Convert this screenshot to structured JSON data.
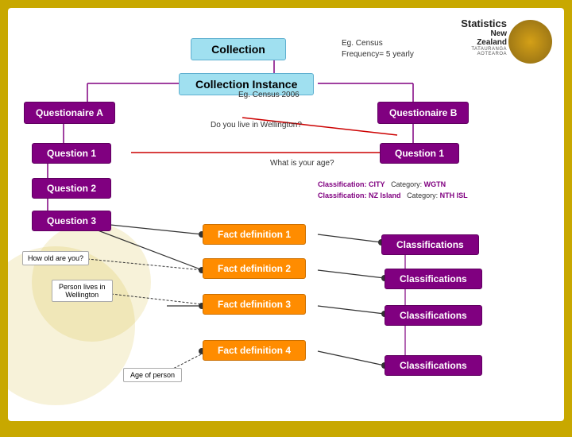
{
  "logo": {
    "line1": "Statistics",
    "line2": "New Zealand",
    "line3": "TATAURANGA AOTEAROA"
  },
  "nodes": {
    "collection": "Collection",
    "collection_instance": "Collection Instance",
    "questionnaire_a": "Questionaire A",
    "questionnaire_b": "Questionaire B",
    "question1_left": "Question 1",
    "question1_right": "Question 1",
    "question2": "Question 2",
    "question3": "Question 3",
    "fact_def_1": "Fact definition 1",
    "fact_def_2": "Fact definition 2",
    "fact_def_3": "Fact definition 3",
    "fact_def_4": "Fact definition 4",
    "classifications_1": "Classifications",
    "classifications_2": "Classifications",
    "classifications_3": "Classifications",
    "classifications_4": "Classifications"
  },
  "labels": {
    "eg_census": "Eg. Census\nFrequency= 5 yearly",
    "eg_census_2006": "Eg. Census 2006",
    "do_you_live": "Do you live in Wellington?",
    "what_is_your_age": "What is your age?",
    "classification_city": "Classification:",
    "classification_city_label": "CITY",
    "category_wgtn": "Category:",
    "category_wgtn_val": "WGTN",
    "classification_nz": "Classification:",
    "classification_nz_label": "NZ Island",
    "category_nth": "Category:",
    "category_nth_val": "NTH ISL",
    "how_old": "How old are you?",
    "person_lives": "Person lives in\nWellington",
    "age_of_person": "Age of person"
  }
}
